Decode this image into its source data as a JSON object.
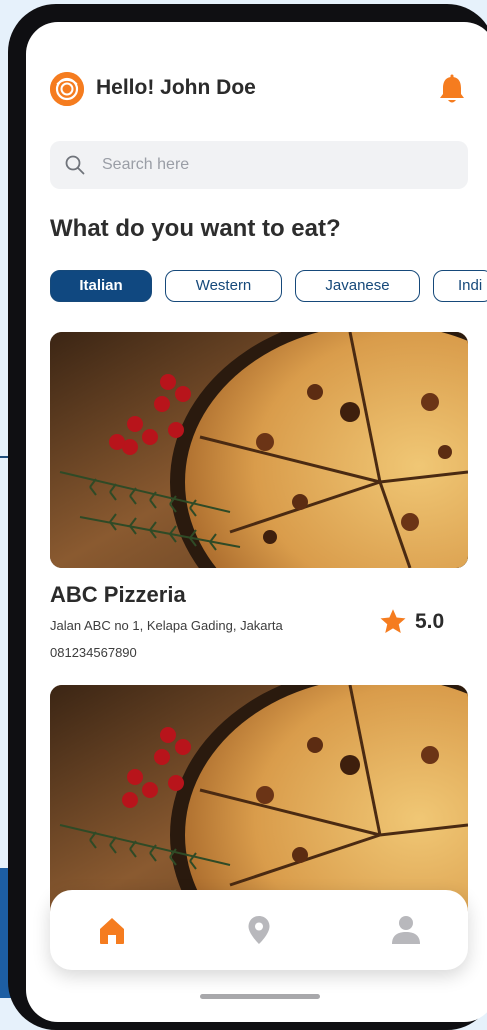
{
  "header": {
    "greeting": "Hello! John Doe",
    "logo_icon": "bowl-logo-icon",
    "notification_icon": "bell-icon"
  },
  "search": {
    "placeholder": "Search here",
    "icon": "search-icon"
  },
  "section_title": "What do you want to eat?",
  "categories": [
    {
      "label": "Italian",
      "active": true
    },
    {
      "label": "Western",
      "active": false
    },
    {
      "label": "Javanese",
      "active": false
    },
    {
      "label": "Indi",
      "active": false
    }
  ],
  "restaurants": [
    {
      "name": "ABC Pizzeria",
      "address": "Jalan ABC no 1, Kelapa Gading, Jakarta",
      "phone": "081234567890",
      "rating": "5.0",
      "image": "pizza-photo"
    },
    {
      "image": "pizza-photo"
    }
  ],
  "bottom_nav": [
    {
      "icon": "home-icon",
      "active": true
    },
    {
      "icon": "location-pin-icon",
      "active": false
    },
    {
      "icon": "profile-icon",
      "active": false
    }
  ],
  "colors": {
    "accent": "#f57c1f",
    "primary": "#104880",
    "inactive_icon": "#b8b8bc",
    "background": "#e6f1fb"
  }
}
